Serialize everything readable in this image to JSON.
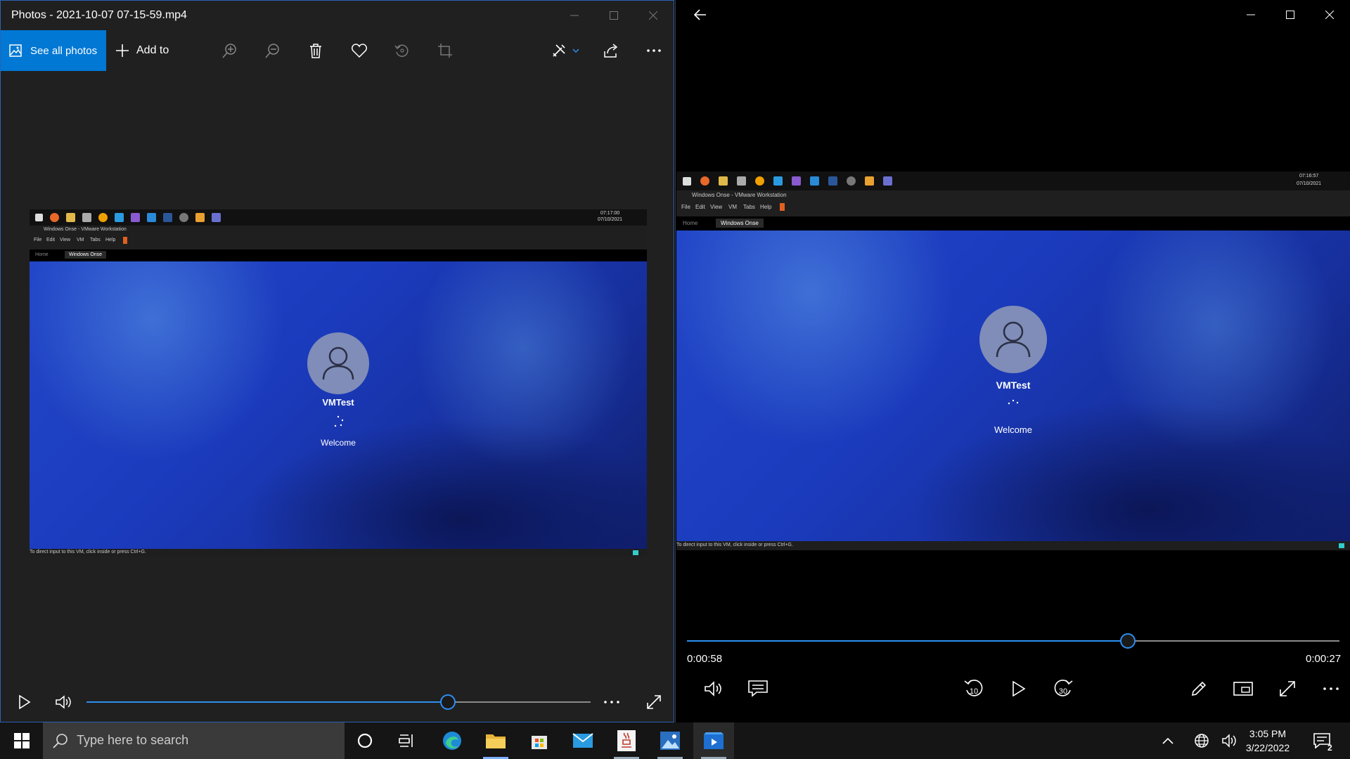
{
  "left_window": {
    "title": "Photos - 2021-10-07 07-15-59.mp4",
    "toolbar": {
      "see_all_label": "See all photos",
      "add_to_label": "Add to"
    },
    "video_frame": {
      "vm_title": "Windows Onse - VMware Workstation",
      "menu": [
        "File",
        "Edit",
        "View",
        "VM",
        "Tabs",
        "Help"
      ],
      "tabs": [
        "Home",
        "Windows Onse"
      ],
      "clock_time": "07:17:00",
      "clock_date": "07/10/2021",
      "user_name": "VMTest",
      "status_text": "Welcome",
      "status_bar": "To direct input to this VM, click inside or press Ctrl+G."
    },
    "seek_progress": 0.717
  },
  "right_window": {
    "video_frame": {
      "vm_title": "Windows Onse - VMware Workstation",
      "menu": [
        "File",
        "Edit",
        "View",
        "VM",
        "Tabs",
        "Help"
      ],
      "tabs": [
        "Home",
        "Windows Onse"
      ],
      "clock_time": "07:16:57",
      "clock_date": "07/10/2021",
      "user_name": "VMTest",
      "status_text": "Welcome",
      "status_bar": "To direct input to this VM, click inside or press Ctrl+G."
    },
    "elapsed": "0:00:58",
    "remaining": "0:00:27",
    "seek_progress": 0.676,
    "skip_back_label": "10",
    "skip_forward_label": "30"
  },
  "taskbar": {
    "search_placeholder": "Type here to search",
    "time": "3:05 PM",
    "date": "3/22/2022",
    "notification_count": "2"
  },
  "colors": {
    "accent": "#0078d4",
    "slider": "#2d8ef0",
    "window_bg": "#202020"
  }
}
